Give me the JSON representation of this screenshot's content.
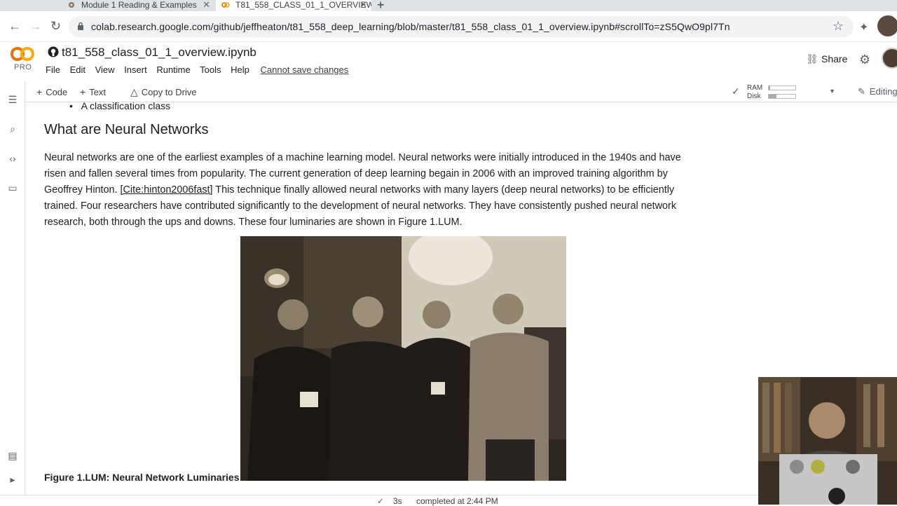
{
  "browser": {
    "tabs": [
      {
        "label": "Module 1 Reading & Examples",
        "active": false
      },
      {
        "label": "T81_558_CLASS_01_1_OVERVIEW",
        "active": true
      }
    ],
    "url": "colab.research.google.com/github/jeffheaton/t81_558_deep_learning/blob/master/t81_558_class_01_1_overview.ipynb#scrollTo=zS5QwO9pl7Tn"
  },
  "colab": {
    "pro_label": "PRO",
    "notebook_title": "t81_558_class_01_1_overview.ipynb",
    "menu": [
      "File",
      "Edit",
      "View",
      "Insert",
      "Runtime",
      "Tools",
      "Help"
    ],
    "save_notice": "Cannot save changes",
    "share_label": "Share",
    "toolbar": {
      "code_label": "Code",
      "text_label": "Text",
      "copy_label": "Copy to Drive",
      "ram_label": "RAM",
      "disk_label": "Disk",
      "ram_level": 0.05,
      "disk_level": 0.3,
      "editing_label": "Editing"
    }
  },
  "content": {
    "bullet_text": "A classification class",
    "heading": "What are Neural Networks",
    "paragraph_before_cite": "Neural networks are one of the earliest examples of a machine learning model. Neural networks were initially introduced in the 1940s and have risen and fallen several times from popularity. The current generation of deep learning begain in 2006 with an improved training algorithm by Geoffrey Hinton. ",
    "cite": "[Cite:hinton2006fast]",
    "paragraph_after_cite": " This technique finally allowed neural networks with many layers (deep neural networks) to be efficiently trained. Four researchers have contributed significantly to the development of neural networks. They have consistently pushed neural network research, both through the ups and downs. These four luminaries are shown in Figure 1.LUM.",
    "caption": "Figure 1.LUM: Neural Network Luminaries"
  },
  "status": {
    "duration": "3s",
    "completed": "completed at 2:44 PM"
  },
  "colors": {
    "accent": "#f9ab00",
    "text": "#202124",
    "muted": "#5f6368"
  }
}
